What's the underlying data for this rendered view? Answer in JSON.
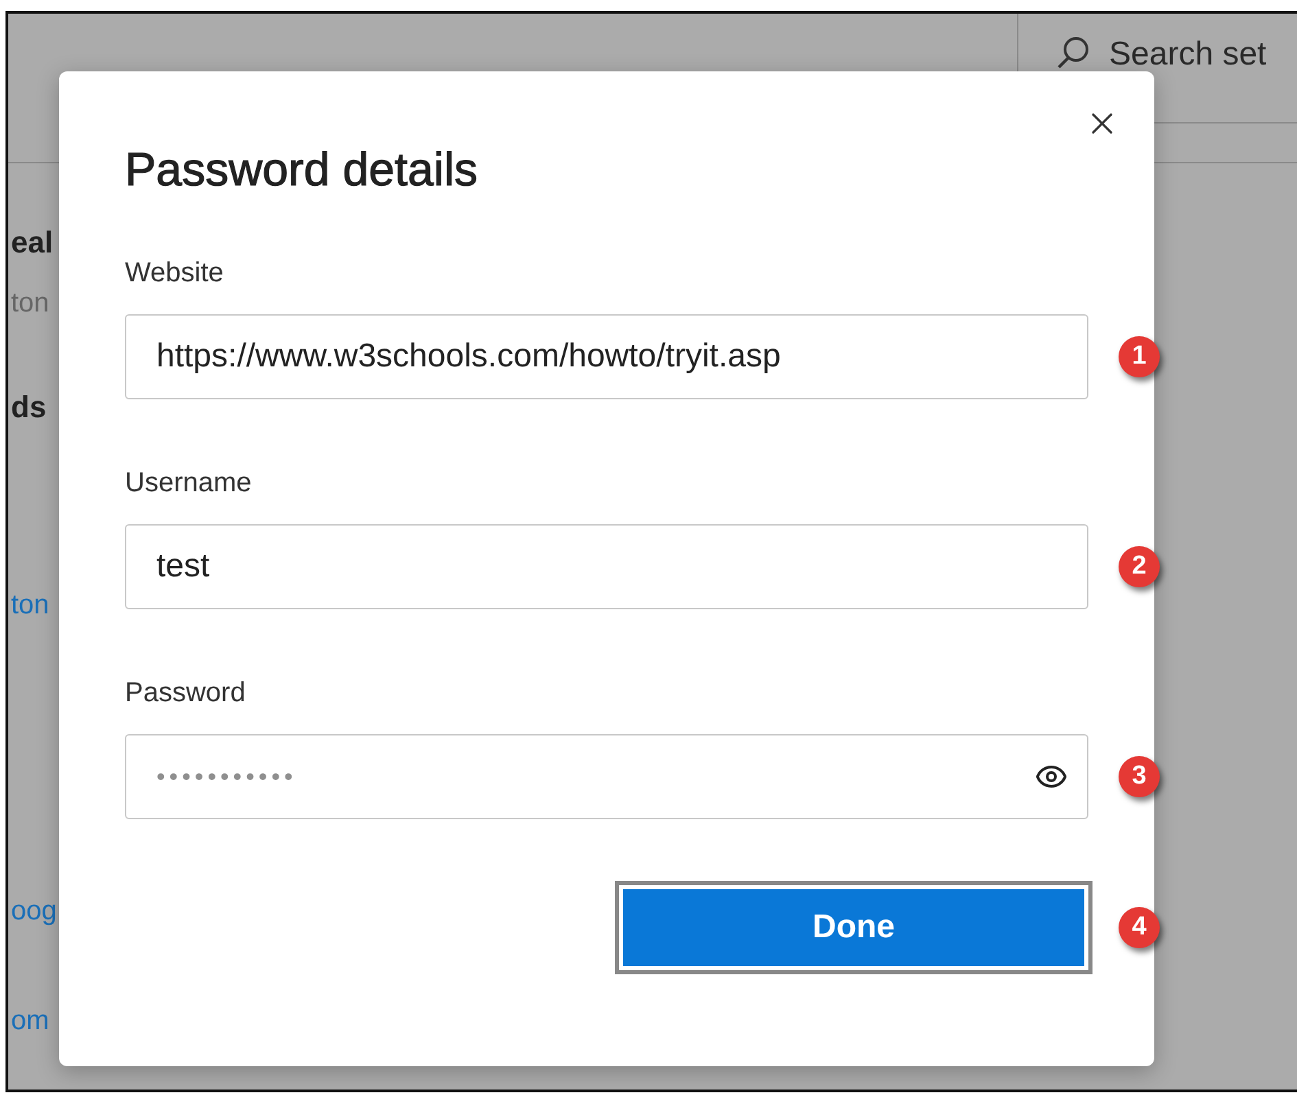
{
  "header": {
    "search": {
      "placeholder": "Search set"
    }
  },
  "background_items": [
    {
      "kind": "heading",
      "text": "eal"
    },
    {
      "kind": "subtext",
      "text": "ton"
    },
    {
      "kind": "heading",
      "text": "ds"
    },
    {
      "kind": "link",
      "text": "ton"
    },
    {
      "kind": "link",
      "text": "oog"
    },
    {
      "kind": "link",
      "text": "om"
    }
  ],
  "dialog": {
    "title": "Password details",
    "fields": [
      {
        "kind": "text",
        "label": "Website",
        "value": "https://www.w3schools.com/howto/tryit.asp",
        "badge": "1"
      },
      {
        "kind": "text",
        "label": "Username",
        "value": "test",
        "badge": "2"
      },
      {
        "kind": "password",
        "label": "Password",
        "value": "•••••••••••",
        "badge": "3"
      }
    ],
    "done_button": {
      "label": "Done",
      "focused": true,
      "badge": "4"
    }
  }
}
